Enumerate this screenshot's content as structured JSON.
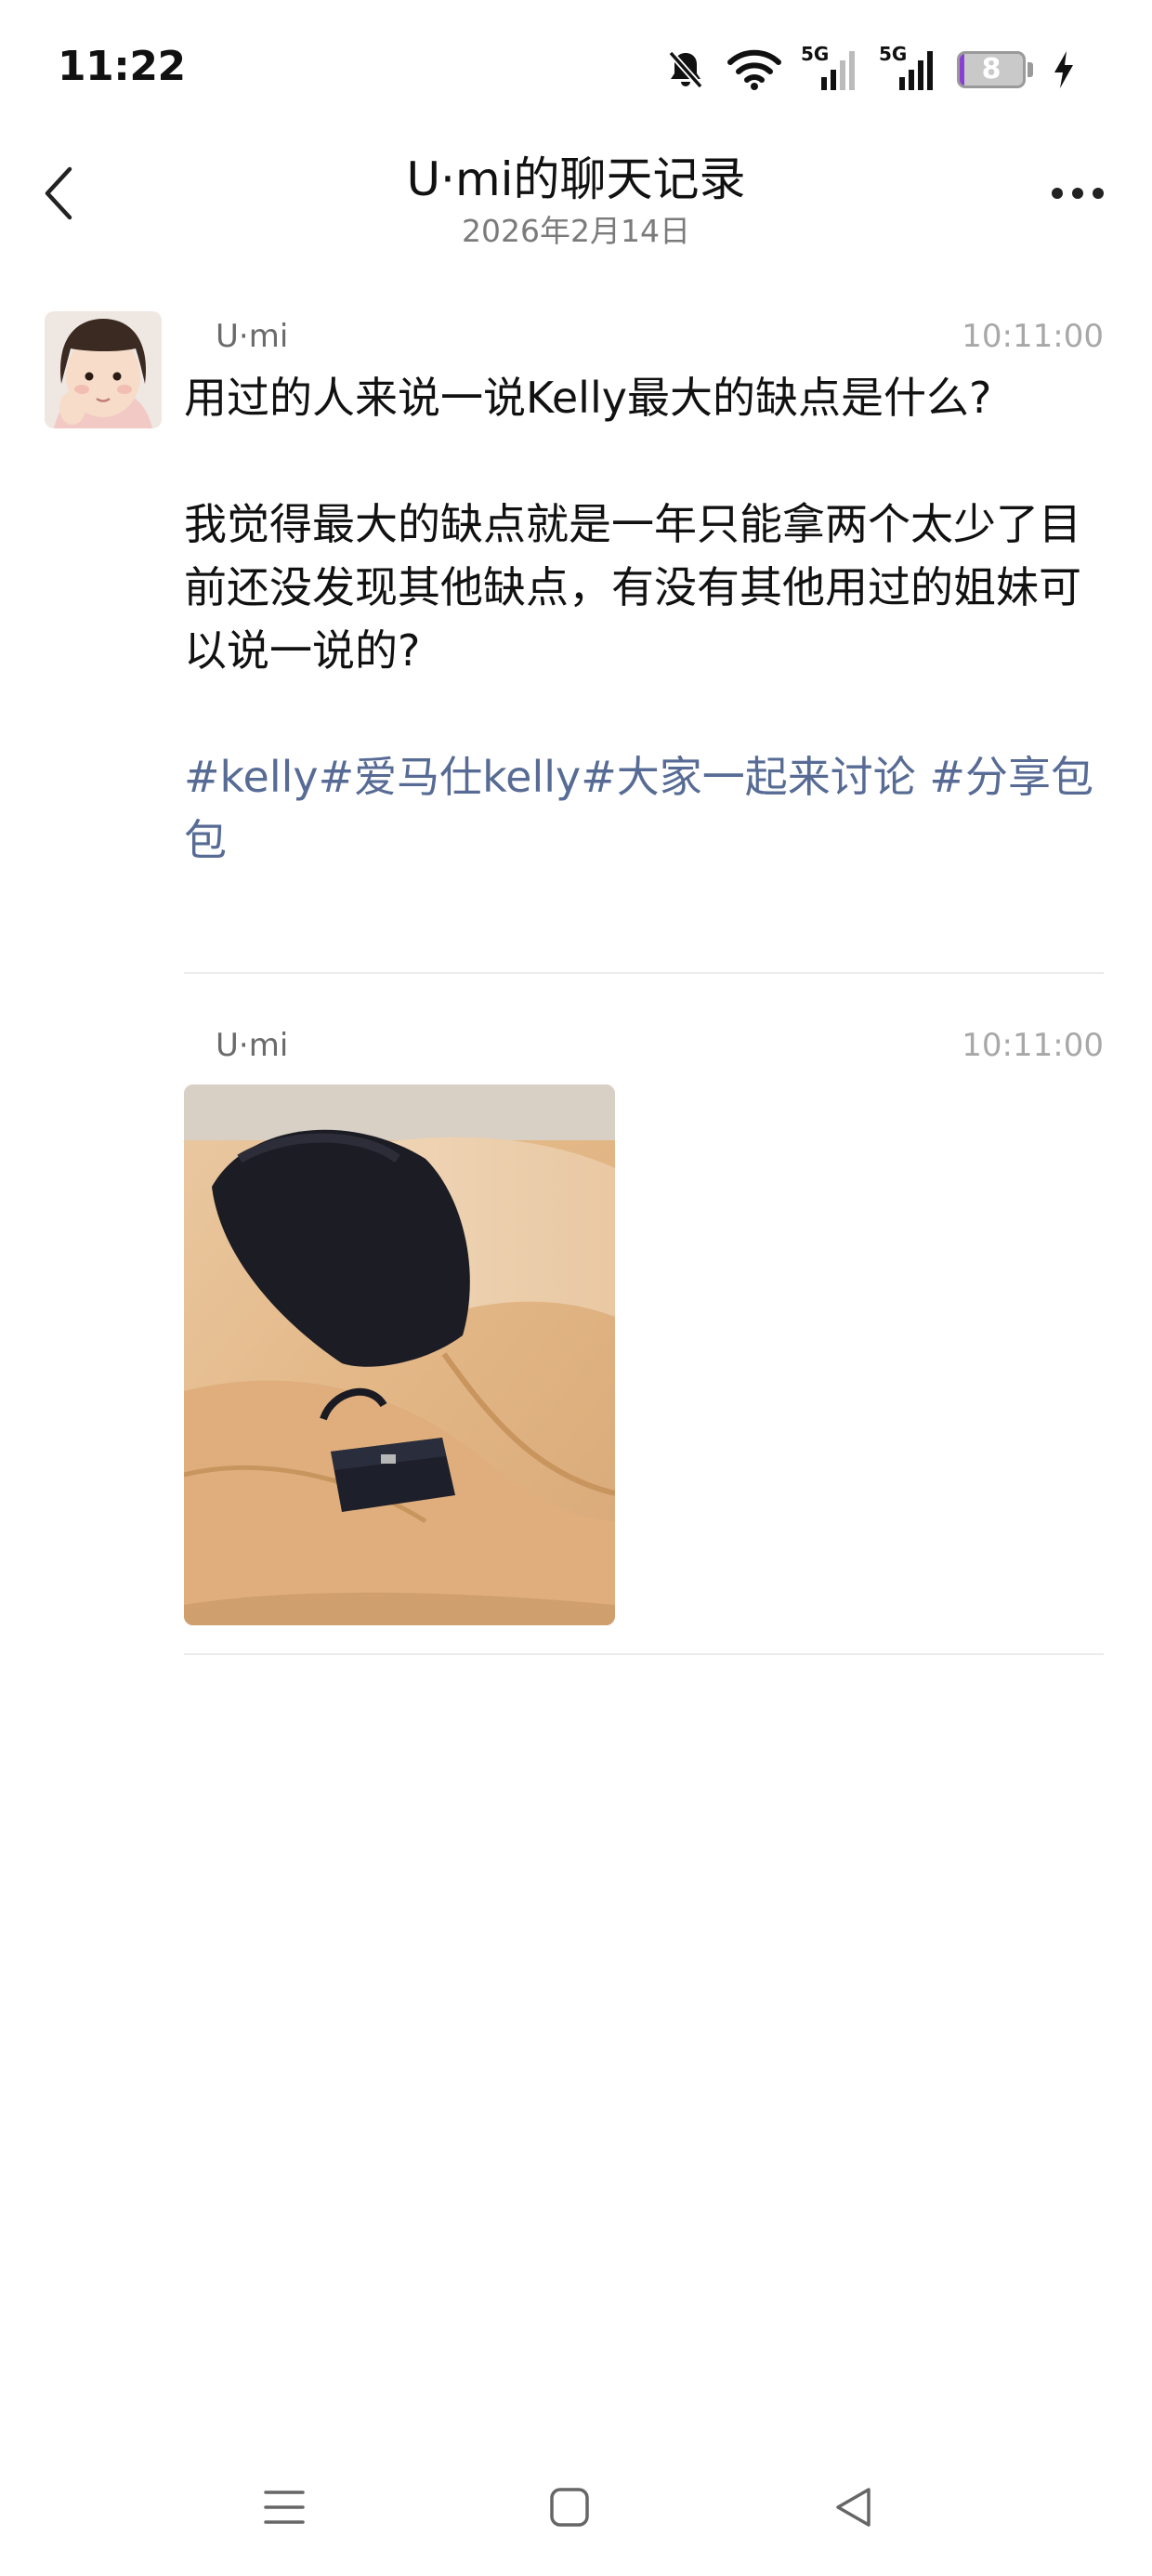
{
  "status_bar": {
    "time": "11:22",
    "battery_level": "8",
    "battery_fraction": 0.08,
    "network_labels": [
      "5G",
      "5G"
    ],
    "icons": [
      "mute-bell-icon",
      "wifi-icon",
      "signal-5g-icon",
      "signal-5g-icon",
      "battery-icon",
      "charging-bolt-icon"
    ]
  },
  "header": {
    "title": "U·mi的聊天记录",
    "subtitle": "2026年2月14日",
    "back_icon": "chevron-left-icon",
    "more_icon": "more-dots-icon"
  },
  "messages": [
    {
      "sender": "U·mi",
      "time": "10:11:00",
      "type": "text",
      "paragraphs": [
        "用过的人来说一说Kelly最大的缺点是什么?",
        "我觉得最大的缺点就是一年只能拿两个太少了目前还没发现其他缺点，有没有其他用过的姐妹可以说一说的?"
      ],
      "hashtags": "#kelly#爱马仕kelly#大家一起来讨论 #分享包包"
    },
    {
      "sender": "U·mi",
      "time": "10:11:00",
      "type": "image",
      "image_icon": "photo-black-kelly-bag-on-leather-seat"
    }
  ],
  "nav_bar": {
    "icons": [
      "menu-icon",
      "home-square-icon",
      "back-triangle-icon"
    ]
  },
  "colors": {
    "hashtag": "#576b95",
    "timestamp": "#a8a8a8",
    "sender": "#6b6b6b",
    "battery_accent": "#8a3fd4"
  }
}
